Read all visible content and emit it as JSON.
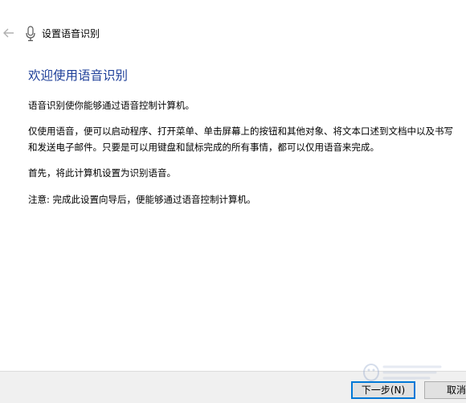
{
  "header": {
    "title": "设置语音识别",
    "back_icon": "arrow-left-icon",
    "app_icon": "microphone-icon"
  },
  "main": {
    "heading": "欢迎使用语音识别",
    "paragraphs": [
      "语音识别使你能够通过语音控制计算机。",
      "仅使用语音，便可以启动程序、打开菜单、单击屏幕上的按钮和其他对象、将文本口述到文档中以及书写和发送电子邮件。只要是可以用键盘和鼠标完成的所有事情，都可以仅用语音来完成。",
      "首先，将此计算机设置为识别语音。",
      "注意: 完成此设置向导后，便能够通过语音控制计算机。"
    ]
  },
  "footer": {
    "next_label": "下一步(N)",
    "cancel_label": "取消"
  },
  "colors": {
    "heading": "#1e3f99",
    "accent": "#0078d7",
    "footer_bg": "#f0f0f0"
  }
}
